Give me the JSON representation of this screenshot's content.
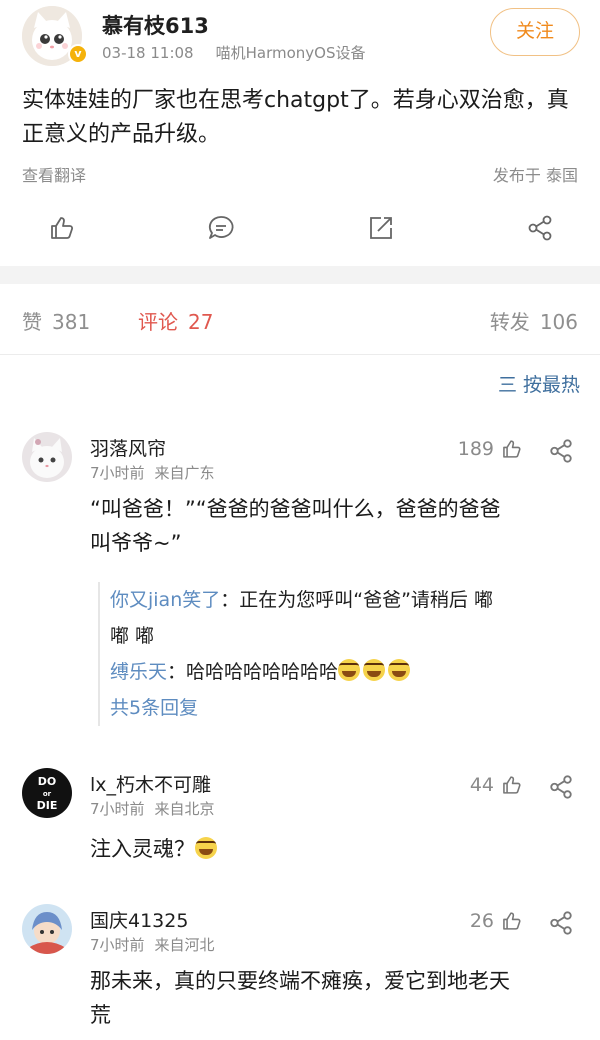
{
  "post": {
    "username": "慕有枝613",
    "time": "03-18 11:08",
    "device": "喵机HarmonyOS设备",
    "follow_label": "关注",
    "content": "实体娃娃的厂家也在思考chatgpt了。若身心双治愈，真正意义的产品升级。",
    "translate_label": "查看翻译",
    "location": "发布于 泰国",
    "verified_glyph": "v"
  },
  "actions": [
    "like-icon",
    "comment-icon",
    "repost-icon",
    "share-icon"
  ],
  "stats": {
    "likes_label": "赞",
    "likes_count": "381",
    "comments_label": "评论",
    "comments_count": "27",
    "reposts_label": "转发",
    "reposts_count": "106"
  },
  "sort": {
    "glyph": "三",
    "label": "按最热"
  },
  "comments": [
    {
      "name": "羽落风帘",
      "time": "7小时前",
      "location": "来自广东",
      "likes": "189",
      "text_line1": "“叫爸爸！”“爸爸的爸爸叫什么，爸爸的爸爸",
      "text_line2": "叫爷爷~”",
      "replies": [
        {
          "name": "你又jian笑了",
          "text_line1": "：正在为您呼叫“爸爸”请稍后 嘟",
          "text_line2": "嘟 嘟"
        },
        {
          "name": "缚乐天",
          "text_line1": "：哈哈哈哈哈哈哈哈"
        }
      ],
      "more_replies": "共5条回复"
    },
    {
      "name": "lx_朽木不可雕",
      "time": "7小时前",
      "location": "来自北京",
      "likes": "44",
      "avatar_text_top": "DO",
      "avatar_text_mid": "or",
      "avatar_text_bottom": "DIE",
      "text_line1": "注入灵魂？"
    },
    {
      "name": "国庆41325",
      "time": "7小时前",
      "location": "来自河北",
      "likes": "26",
      "text_line1": "那未来，真的只要终端不瘫痪，爱它到地老天",
      "text_line2": "荒"
    }
  ],
  "colors": {
    "accent_orange": "#f08a1c",
    "comment_tab_red": "#e0584f",
    "link_blue": "#5e8cc0",
    "meta_gray": "#8a8a8a"
  }
}
